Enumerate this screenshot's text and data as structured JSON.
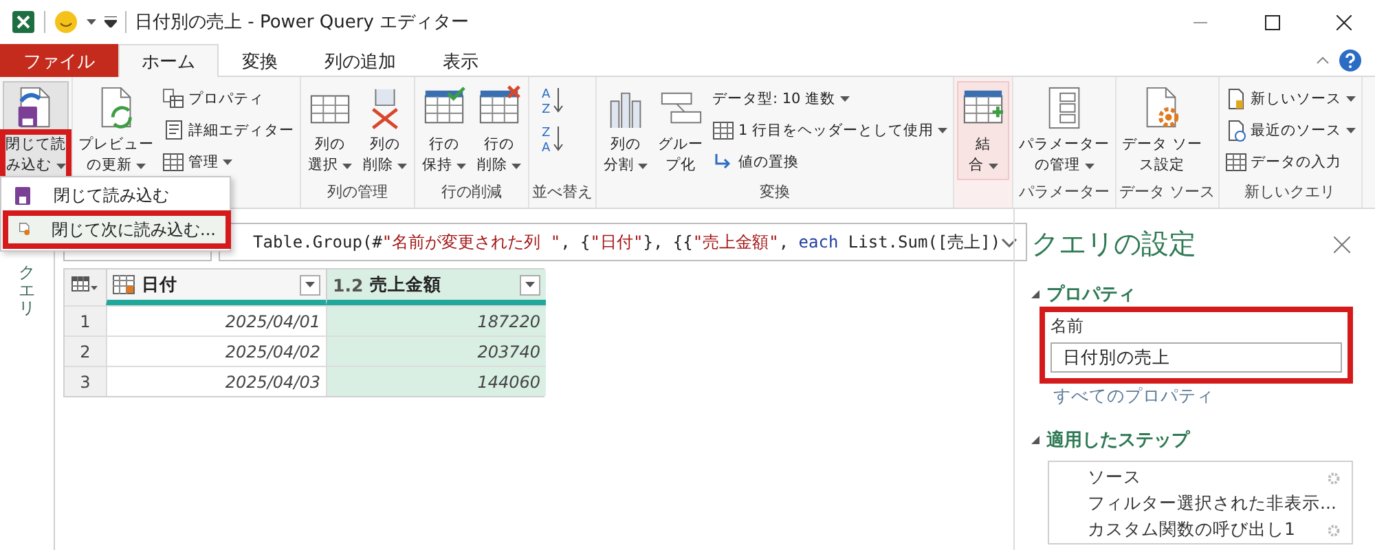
{
  "window": {
    "title": "日付別の売上 - Power Query エディター"
  },
  "tabs": [
    {
      "label": "ファイル",
      "kind": "file",
      "selected": false
    },
    {
      "label": "ホーム",
      "kind": "tab",
      "selected": true
    },
    {
      "label": "変換",
      "kind": "tab",
      "selected": false
    },
    {
      "label": "列の追加",
      "kind": "tab",
      "selected": false
    },
    {
      "label": "表示",
      "kind": "tab",
      "selected": false
    }
  ],
  "ribbon": {
    "groups": [
      {
        "items": [
          {
            "kind": "large",
            "lines": [
              "閉じて読",
              "み込む"
            ],
            "dropdown": true,
            "pressed": true,
            "annotated": true
          }
        ]
      },
      {
        "items": [
          {
            "kind": "large",
            "lines": [
              "プレビュー",
              "の更新"
            ],
            "dropdown": true,
            "pressed": false,
            "annotated": false
          },
          {
            "kind": "small",
            "label": "プロパティ",
            "dropdown": false
          },
          {
            "kind": "small",
            "label": "詳細エディター",
            "dropdown": false
          },
          {
            "kind": "small",
            "label": "管理",
            "dropdown": true
          }
        ]
      },
      {
        "label": "列の管理",
        "items": [
          {
            "kind": "large",
            "lines": [
              "列の",
              "選択"
            ],
            "dropdown": true,
            "pressed": false,
            "annotated": false
          },
          {
            "kind": "large",
            "lines": [
              "列の",
              "削除"
            ],
            "dropdown": true,
            "pressed": false,
            "annotated": false
          }
        ]
      },
      {
        "label": "行の削減",
        "items": [
          {
            "kind": "large",
            "lines": [
              "行の",
              "保持"
            ],
            "dropdown": true,
            "pressed": false,
            "annotated": false
          },
          {
            "kind": "large",
            "lines": [
              "行の",
              "削除"
            ],
            "dropdown": true,
            "pressed": false,
            "annotated": false
          }
        ]
      },
      {
        "label": "並べ替え",
        "items": [
          {
            "kind": "sort",
            "top": "A",
            "bottom": "Z"
          },
          {
            "kind": "sort",
            "top": "Z",
            "bottom": "A"
          }
        ]
      },
      {
        "label": "変換",
        "items": [
          {
            "kind": "large",
            "lines": [
              "列の",
              "分割"
            ],
            "dropdown": true,
            "pressed": false,
            "annotated": false
          },
          {
            "kind": "large",
            "lines": [
              "グルー",
              "プ化"
            ],
            "dropdown": false,
            "pressed": false,
            "annotated": false
          },
          {
            "kind": "small",
            "label": "データ型: 10 進数",
            "dropdown": true
          },
          {
            "kind": "small",
            "label": "1 行目をヘッダーとして使用",
            "dropdown": true
          },
          {
            "kind": "small",
            "label": "値の置換",
            "dropdown": false
          }
        ]
      },
      {
        "hovered": true,
        "items": [
          {
            "kind": "large",
            "lines": [
              "結",
              "合"
            ],
            "dropdown": true,
            "pressed": false,
            "annotated": false
          }
        ]
      },
      {
        "label": "パラメーター",
        "items": [
          {
            "kind": "large",
            "lines": [
              "パラメーター",
              "の管理"
            ],
            "dropdown": true,
            "pressed": false,
            "annotated": false
          }
        ]
      },
      {
        "label": "データ ソース",
        "items": [
          {
            "kind": "large",
            "lines": [
              "データ ソー",
              "ス設定"
            ],
            "dropdown": false,
            "pressed": false,
            "annotated": false
          }
        ]
      },
      {
        "label": "新しいクエリ",
        "items": [
          {
            "kind": "small",
            "label": "新しいソース",
            "dropdown": true
          },
          {
            "kind": "small",
            "label": "最近のソース",
            "dropdown": true
          },
          {
            "kind": "small",
            "label": "データの入力",
            "dropdown": false
          }
        ]
      }
    ]
  },
  "menu": {
    "items": [
      {
        "label": "閉じて読み込む",
        "annotated": false
      },
      {
        "label": "閉じて次に読み込む...",
        "annotated": true
      }
    ]
  },
  "queries_pane": {
    "label": "クエリ"
  },
  "formula": {
    "tokens": [
      {
        "kind": "plain",
        "text": "Table.Group(#"
      },
      {
        "kind": "string",
        "text": "\"名前が変更された列 \""
      },
      {
        "kind": "plain",
        "text": ", {"
      },
      {
        "kind": "string",
        "text": "\"日付\""
      },
      {
        "kind": "plain",
        "text": "}, {{"
      },
      {
        "kind": "string",
        "text": "\"売上金額\""
      },
      {
        "kind": "plain",
        "text": ", "
      },
      {
        "kind": "keyword",
        "text": "each"
      },
      {
        "kind": "plain",
        "text": " List.Sum([売上])"
      }
    ]
  },
  "table": {
    "columns": [
      {
        "kind": "date",
        "label": "日付",
        "selected": false
      },
      {
        "kind": "number",
        "type_text": "1.2",
        "label": "売上金額",
        "selected": true
      }
    ],
    "rows": [
      {
        "number": "1",
        "cells": [
          "2025/04/01",
          "187220"
        ]
      },
      {
        "number": "2",
        "cells": [
          "2025/04/02",
          "203740"
        ]
      },
      {
        "number": "3",
        "cells": [
          "2025/04/03",
          "144060"
        ]
      }
    ]
  },
  "settings": {
    "title": "クエリの設定",
    "properties_heading": "プロパティ",
    "name_label": "名前",
    "name_value": "日付別の売上",
    "name_annotated": true,
    "all_properties_link": "すべてのプロパティ",
    "steps_heading": "適用したステップ",
    "steps": [
      {
        "label": "ソース"
      },
      {
        "label": "フィルター選択された非表示..."
      },
      {
        "label": "カスタム関数の呼び出し1"
      }
    ]
  }
}
